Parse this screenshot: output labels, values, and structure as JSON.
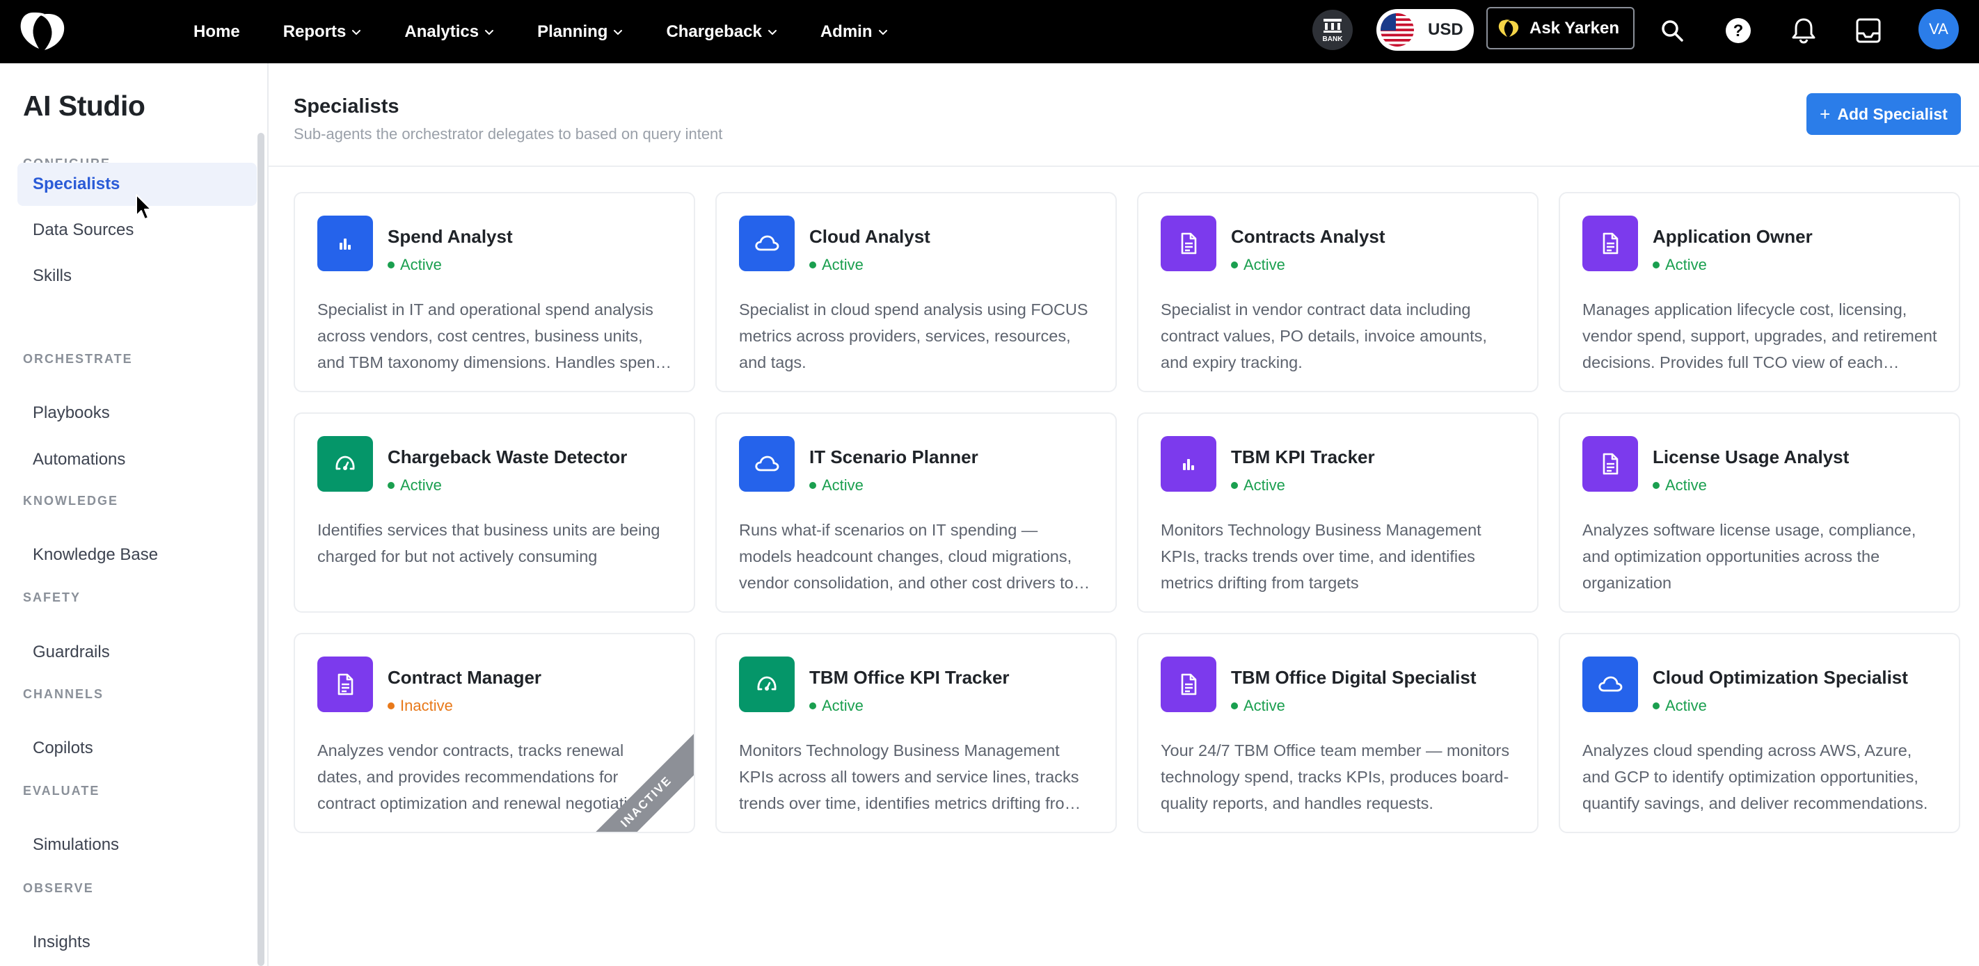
{
  "nav": {
    "items": [
      {
        "label": "Home",
        "has_menu": false
      },
      {
        "label": "Reports",
        "has_menu": true
      },
      {
        "label": "Analytics",
        "has_menu": true
      },
      {
        "label": "Planning",
        "has_menu": true
      },
      {
        "label": "Chargeback",
        "has_menu": true
      },
      {
        "label": "Admin",
        "has_menu": true
      }
    ],
    "bank_label": "BANK",
    "currency": "USD",
    "ask_label": "Ask Yarken",
    "avatar_initials": "VA"
  },
  "sidebar": {
    "title": "AI Studio",
    "sections": [
      {
        "label": "CONFIGURE",
        "items": [
          "Specialists",
          "Data Sources",
          "Skills"
        ]
      },
      {
        "label": "ORCHESTRATE",
        "items": [
          "Playbooks",
          "Automations"
        ]
      },
      {
        "label": "KNOWLEDGE",
        "items": [
          "Knowledge Base"
        ]
      },
      {
        "label": "SAFETY",
        "items": [
          "Guardrails"
        ]
      },
      {
        "label": "CHANNELS",
        "items": [
          "Copilots"
        ]
      },
      {
        "label": "EVALUATE",
        "items": [
          "Simulations"
        ]
      },
      {
        "label": "OBSERVE",
        "items": [
          "Insights"
        ]
      }
    ],
    "active_item": "Specialists"
  },
  "main": {
    "title": "Specialists",
    "subtitle": "Sub-agents the orchestrator delegates to based on query intent",
    "add_button": "Add Specialist",
    "inactive_ribbon": "INACTIVE",
    "cards": [
      {
        "name": "Spend Analyst",
        "status": "Active",
        "icon": "bar-chart-icon",
        "color": "#2563eb",
        "description": "Specialist in IT and operational spend analysis across vendors, cost centres, business units, and TBM taxonomy dimensions. Handles spend trends, variance analysis, and forecasting."
      },
      {
        "name": "Cloud Analyst",
        "status": "Active",
        "icon": "cloud-icon",
        "color": "#2563eb",
        "description": "Specialist in cloud spend analysis using FOCUS metrics across providers, services, resources, and tags."
      },
      {
        "name": "Contracts Analyst",
        "status": "Active",
        "icon": "document-icon",
        "color": "#7c3aed",
        "description": "Specialist in vendor contract data including contract values, PO details, invoice amounts, and expiry tracking."
      },
      {
        "name": "Application Owner",
        "status": "Active",
        "icon": "document-icon",
        "color": "#7c3aed",
        "description": "Manages application lifecycle cost, licensing, vendor spend, support, upgrades, and retirement decisions. Provides full TCO view of each application."
      },
      {
        "name": "Chargeback Waste Detector",
        "status": "Active",
        "icon": "gauge-icon",
        "color": "#059669",
        "description": "Identifies services that business units are being charged for but not actively consuming"
      },
      {
        "name": "IT Scenario Planner",
        "status": "Active",
        "icon": "cloud-icon",
        "color": "#2563eb",
        "description": "Runs what-if scenarios on IT spending — models headcount changes, cloud migrations, vendor consolidation, and other cost drivers to forecast impact."
      },
      {
        "name": "TBM KPI Tracker",
        "status": "Active",
        "icon": "bar-chart-icon",
        "color": "#7c3aed",
        "description": "Monitors Technology Business Management KPIs, tracks trends over time, and identifies metrics drifting from targets"
      },
      {
        "name": "License Usage Analyst",
        "status": "Active",
        "icon": "document-icon",
        "color": "#7c3aed",
        "description": "Analyzes software license usage, compliance, and optimization opportunities across the organization"
      },
      {
        "name": "Contract Manager",
        "status": "Inactive",
        "icon": "document-icon",
        "color": "#7c3aed",
        "description": "Analyzes vendor contracts, tracks renewal dates, and provides recommendations for contract optimization and renewal negotiations."
      },
      {
        "name": "TBM Office KPI Tracker",
        "status": "Active",
        "icon": "gauge-icon",
        "color": "#059669",
        "description": "Monitors Technology Business Management KPIs across all towers and service lines, tracks trends over time, identifies metrics drifting from targets."
      },
      {
        "name": "TBM Office Digital Specialist",
        "status": "Active",
        "icon": "document-icon",
        "color": "#7c3aed",
        "description": "Your 24/7 TBM Office team member — monitors technology spend, tracks KPIs, produces board-quality reports, and handles requests."
      },
      {
        "name": "Cloud Optimization Specialist",
        "status": "Active",
        "icon": "cloud-icon",
        "color": "#2563eb",
        "description": "Analyzes cloud spending across AWS, Azure, and GCP to identify optimization opportunities, quantify savings, and deliver recommendations."
      }
    ]
  },
  "colors": {
    "active": "#1a9f4f",
    "inactive": "#e8791a",
    "accent": "#2b7de9"
  }
}
